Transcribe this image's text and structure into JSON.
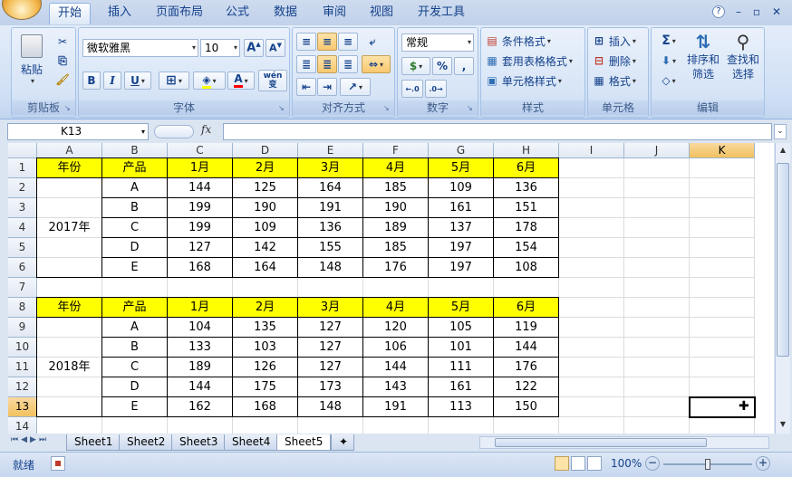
{
  "ribbon_tabs": [
    "开始",
    "插入",
    "页面布局",
    "公式",
    "数据",
    "审阅",
    "视图",
    "开发工具"
  ],
  "active_tab": "开始",
  "clipboard": {
    "paste_label": "粘贴",
    "group_label": "剪贴板"
  },
  "font": {
    "name": "微软雅黑",
    "size": "10",
    "bold": "B",
    "italic": "I",
    "underline": "U",
    "phonetic": "wén\n变",
    "group_label": "字体"
  },
  "alignment": {
    "group_label": "对齐方式"
  },
  "number": {
    "format": "常规",
    "percent": "%",
    "comma": ",",
    "group_label": "数字"
  },
  "styles": {
    "items": [
      "条件格式",
      "套用表格格式",
      "单元格样式"
    ],
    "group_label": "样式"
  },
  "cells": {
    "items": [
      "插入",
      "删除",
      "格式"
    ],
    "group_label": "单元格"
  },
  "editing": {
    "sort_label": "排序和\n筛选",
    "find_label": "查找和\n选择",
    "sigma": "Σ",
    "group_label": "编辑"
  },
  "namebox": "K13",
  "fx": "fx",
  "columns": [
    "A",
    "B",
    "C",
    "D",
    "E",
    "F",
    "G",
    "H",
    "I",
    "J",
    "K"
  ],
  "rows": [
    "1",
    "2",
    "3",
    "4",
    "5",
    "6",
    "7",
    "8",
    "9",
    "10",
    "11",
    "12",
    "13",
    "14"
  ],
  "table1": {
    "headers": [
      "年份",
      "产品",
      "1月",
      "2月",
      "3月",
      "4月",
      "5月",
      "6月"
    ],
    "year": "2017年",
    "data": [
      [
        "A",
        "144",
        "125",
        "164",
        "185",
        "109",
        "136"
      ],
      [
        "B",
        "199",
        "190",
        "191",
        "190",
        "161",
        "151"
      ],
      [
        "C",
        "199",
        "109",
        "136",
        "189",
        "137",
        "178"
      ],
      [
        "D",
        "127",
        "142",
        "155",
        "185",
        "197",
        "154"
      ],
      [
        "E",
        "168",
        "164",
        "148",
        "176",
        "197",
        "108"
      ]
    ]
  },
  "table2": {
    "headers": [
      "年份",
      "产品",
      "1月",
      "2月",
      "3月",
      "4月",
      "5月",
      "6月"
    ],
    "year": "2018年",
    "data": [
      [
        "A",
        "104",
        "135",
        "127",
        "120",
        "105",
        "119"
      ],
      [
        "B",
        "133",
        "103",
        "127",
        "106",
        "101",
        "144"
      ],
      [
        "C",
        "189",
        "126",
        "127",
        "144",
        "111",
        "176"
      ],
      [
        "D",
        "144",
        "175",
        "173",
        "143",
        "161",
        "122"
      ],
      [
        "E",
        "162",
        "168",
        "148",
        "191",
        "113",
        "150"
      ]
    ]
  },
  "sheets": [
    "Sheet1",
    "Sheet2",
    "Sheet3",
    "Sheet4",
    "Sheet5"
  ],
  "active_sheet": "Sheet5",
  "status": {
    "ready": "就绪",
    "zoom": "100%"
  },
  "colors": {
    "header_fill": "#ffff00",
    "ribbon_text": "#15428b",
    "selection": "#000000"
  }
}
